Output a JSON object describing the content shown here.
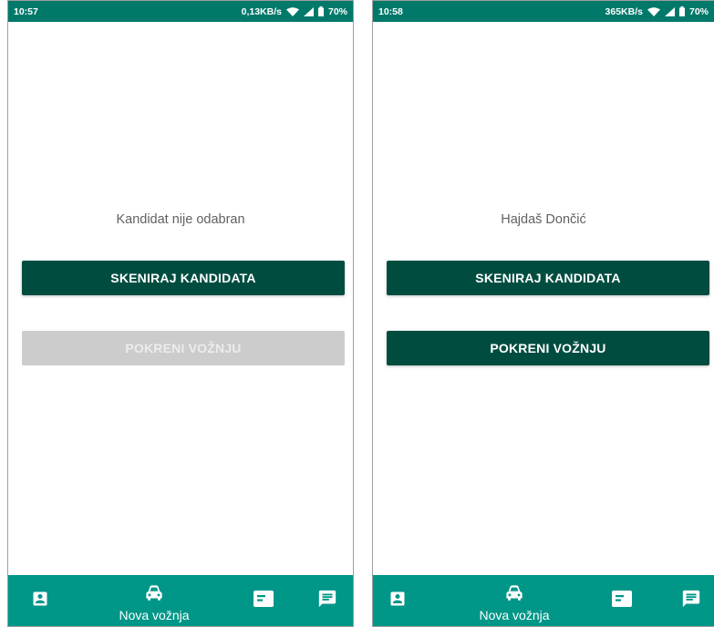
{
  "colors": {
    "status_bar": "#00796b",
    "bottom_nav": "#009688",
    "primary_button": "#004d40",
    "disabled_button": "#cccccc"
  },
  "screens": [
    {
      "status": {
        "time": "10:57",
        "speed": "0,13KB/s",
        "battery": "70%"
      },
      "candidate_text": "Kandidat nije odabran",
      "scan_button": "SKENIRAJ KANDIDATA",
      "start_button": "POKRENI VOŽNJU",
      "start_enabled": false,
      "nav": {
        "items": [
          "account-box-icon",
          "car-icon",
          "card-icon",
          "message-icon"
        ],
        "active_label": "Nova vožnja"
      }
    },
    {
      "status": {
        "time": "10:58",
        "speed": "365KB/s",
        "battery": "70%"
      },
      "candidate_text": "Hajdaš Dončić",
      "scan_button": "SKENIRAJ KANDIDATA",
      "start_button": "POKRENI VOŽNJU",
      "start_enabled": true,
      "nav": {
        "items": [
          "account-box-icon",
          "car-icon",
          "card-icon",
          "message-icon"
        ],
        "active_label": "Nova vožnja"
      }
    }
  ]
}
